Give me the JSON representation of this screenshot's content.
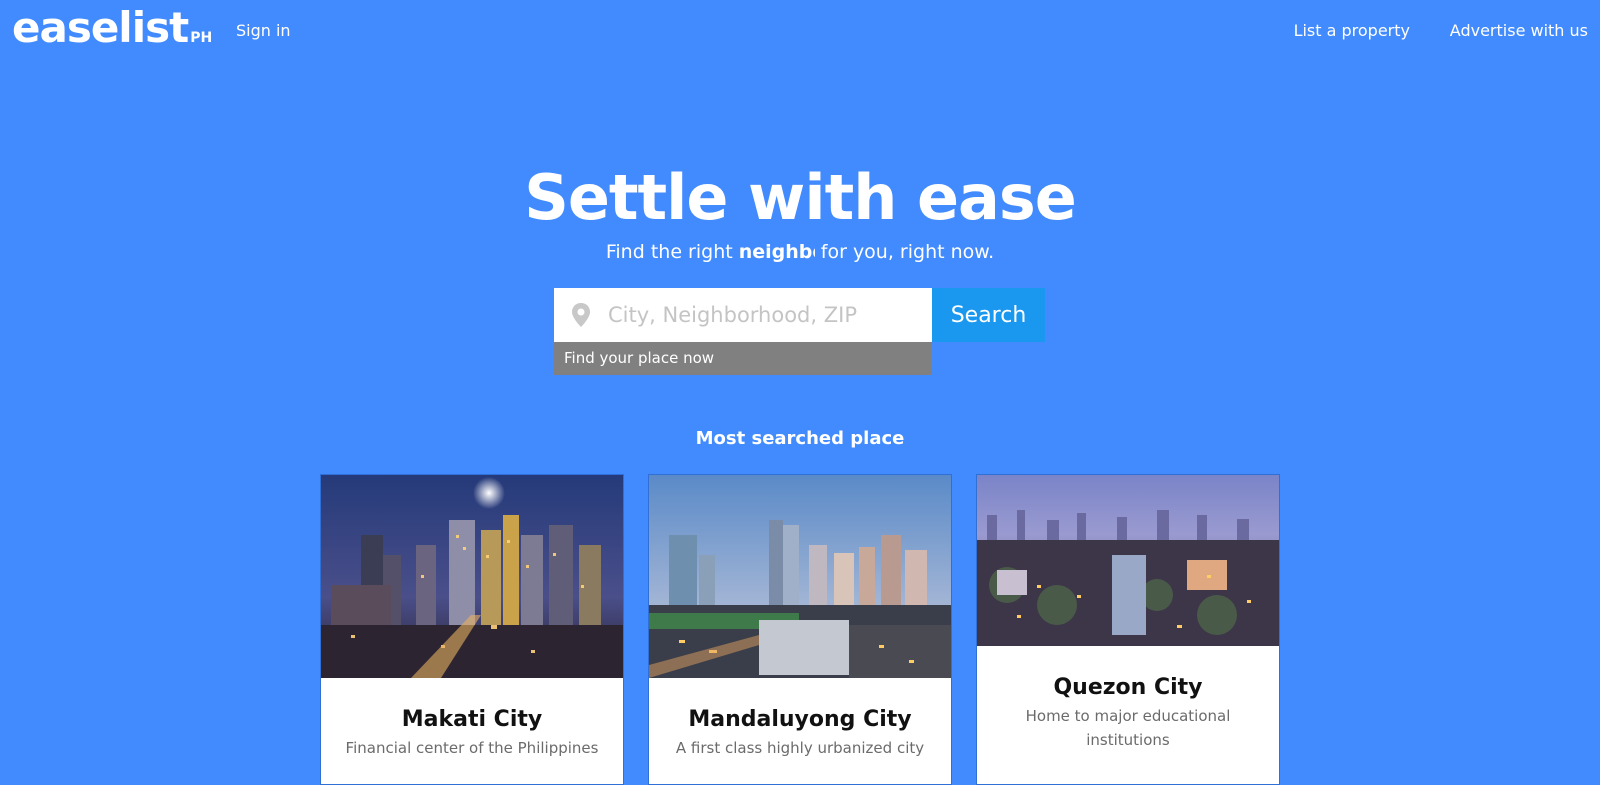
{
  "header": {
    "logo_text": "easelist",
    "logo_sub": "PH",
    "sign_in": "Sign in",
    "list_property": "List a property",
    "advertise": "Advertise with us"
  },
  "hero": {
    "title": "Settle with ease",
    "subtitle_before": "Find the right ",
    "subtitle_typed": "neighbo",
    "subtitle_after": " for you, right now."
  },
  "search": {
    "placeholder": "City, Neighborhood, ZIP",
    "value": "",
    "button_label": "Search",
    "suggestion": "Find your place now",
    "icon": "map-pin-icon"
  },
  "most_searched": {
    "title": "Most searched place",
    "cards": [
      {
        "name": "Makati City",
        "description": "Financial center of the Philippines"
      },
      {
        "name": "Mandaluyong City",
        "description": "A first class highly urbanized city"
      },
      {
        "name": "Quezon City",
        "description": "Home to major educational institutions"
      }
    ]
  },
  "colors": {
    "background": "#428bfe",
    "search_button": "#1a98f0",
    "suggestion_bg": "#808080"
  }
}
